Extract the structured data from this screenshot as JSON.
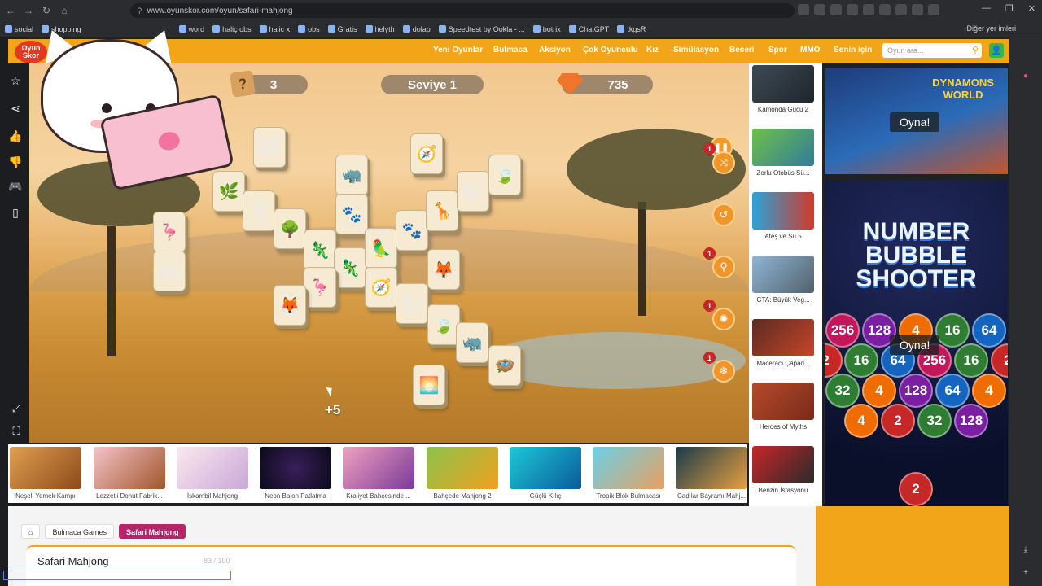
{
  "browser": {
    "url": "www.oyunskor.com/oyun/safari-mahjong",
    "bookmarks": [
      "social",
      "shopping",
      "word",
      "haliç obs",
      "halic x",
      "obs",
      "Gratis",
      "helyth",
      "dolap",
      "Speedtest by Ookla - ...",
      "botrix",
      "ChatGPT",
      "tkgsR"
    ],
    "bookmarks_right": "Diğer yer imleri"
  },
  "site": {
    "logo": "Oyun Skor",
    "nav": [
      "Yeni Oyunlar",
      "Bulmaca",
      "Aksiyon",
      "Çok Oyunculu",
      "Kız",
      "Simülasyon",
      "Beceri",
      "Spor",
      "MMO",
      "Senin için"
    ],
    "search_placeholder": "Oyun ara..."
  },
  "game": {
    "hint_icon": "?",
    "hint_count": "3",
    "level": "Seviye 1",
    "gems": "735",
    "plus_score": "+5",
    "tool_badges": [
      "1",
      "1",
      "1",
      "1"
    ],
    "colors": {
      "tile": "#f6ead2",
      "accent": "#f0952a"
    }
  },
  "side_thumbs": [
    "Kamonda Gücü 2",
    "Zorlu Otobüs Sü...",
    "Ateş ve Su 5",
    "GTA: Büyük Veg...",
    "Maceracı Çapad...",
    "Heroes of Myths",
    "Benzin İstasyonu"
  ],
  "ads": {
    "top_title": "DYNAMONS WORLD",
    "play": "Oyna!",
    "bottom_title": [
      "NUMBER",
      "BUBBLE",
      "SHOOTER"
    ],
    "bubbles": [
      "256",
      "128",
      "4",
      "16",
      "64",
      "2",
      "16",
      "64",
      "256",
      "16",
      "2",
      "32",
      "4",
      "128",
      "64",
      "4",
      "4",
      "2",
      "32",
      "128",
      "2"
    ]
  },
  "bottom_games": [
    "Neşeli Yemek Kampı",
    "Lezzetli Donut Fabrik...",
    "İskambil Mahjong",
    "Neon Balon Patlatma",
    "Kraliyet Bahçesinde ...",
    "Bahçede Mahjong 2",
    "Güçlü Kılıç",
    "Tropik Blok Bulmacası",
    "Cadılar Bayramı Mahj..."
  ],
  "breadcrumb": [
    "Bulmaca Games",
    "Safari Mahjong"
  ],
  "page": {
    "title": "Safari Mahjong",
    "counter": "83 / 100"
  }
}
